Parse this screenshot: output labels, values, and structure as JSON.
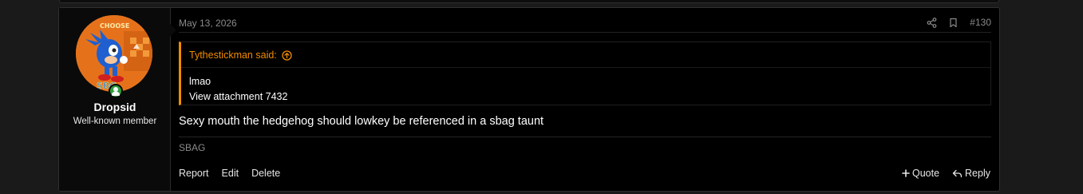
{
  "post": {
    "date": "May 13, 2026",
    "number": "#130",
    "icons": [
      "share-icon",
      "bookmark-icon"
    ],
    "author": {
      "username": "Dropsid",
      "title": "Well-known member",
      "avatar_alt": "user avatar",
      "avatar_text_top": "CHOOSE",
      "avatar_text_bottom": "SBG",
      "online": true
    },
    "quote": {
      "header": "Tythestickman said:",
      "lines": [
        "lmao",
        "View attachment 7432"
      ]
    },
    "message": "Sexy mouth the hedgehog should lowkey be referenced in a sbag taunt",
    "signature": "SBAG",
    "actions_left": [
      "Report",
      "Edit",
      "Delete"
    ],
    "actions_right": {
      "quote": "Quote",
      "reply": "Reply"
    }
  },
  "colors": {
    "accent": "#f08c00",
    "background": "#000000",
    "muted": "#8a8a8a",
    "online": "#2e9e3d"
  }
}
